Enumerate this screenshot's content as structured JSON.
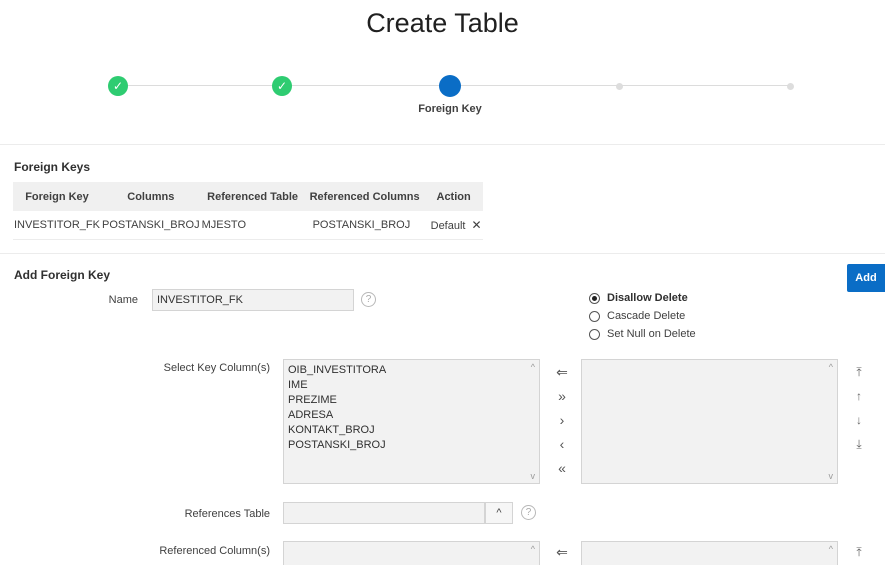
{
  "page": {
    "title": "Create Table"
  },
  "wizard": {
    "current_step_label": "Foreign Key"
  },
  "foreign_keys": {
    "title": "Foreign Keys",
    "headers": [
      "Foreign Key",
      "Columns",
      "Referenced Table",
      "Referenced Columns",
      "Action"
    ],
    "rows": [
      {
        "foreign_key": "INVESTITOR_FK",
        "columns": "POSTANSKI_BROJ",
        "referenced_table": "MJESTO",
        "referenced_columns": "POSTANSKI_BROJ",
        "action": "Default"
      }
    ]
  },
  "add_fk": {
    "title": "Add Foreign Key",
    "add_label": "Add",
    "name_label": "Name",
    "name_value": "INVESTITOR_FK",
    "help_glyph": "?",
    "delete_options": [
      {
        "label": "Disallow Delete",
        "selected": true
      },
      {
        "label": "Cascade Delete",
        "selected": false
      },
      {
        "label": "Set Null on Delete",
        "selected": false
      }
    ],
    "key_columns_label": "Select Key Column(s)",
    "available_columns": [
      "OIB_INVESTITORA",
      "IME",
      "PREZIME",
      "ADRESA",
      "KONTAKT_BROJ",
      "POSTANSKI_BROJ"
    ],
    "references_table_label": "References Table",
    "referenced_columns_label": "Referenced Column(s)"
  },
  "icons": {
    "check": "✓",
    "close": "✕",
    "reset": "⇐",
    "move_all": "»",
    "move": "›",
    "remove": "‹",
    "remove_all": "«",
    "top": "⤒",
    "up": "↑",
    "down": "↓",
    "bottom": "⤓",
    "chevron_up": "^",
    "chevron_down": "v",
    "select_chevron": "^"
  },
  "colors": {
    "primary": "#0a6dc6",
    "success": "#2ecc71"
  }
}
